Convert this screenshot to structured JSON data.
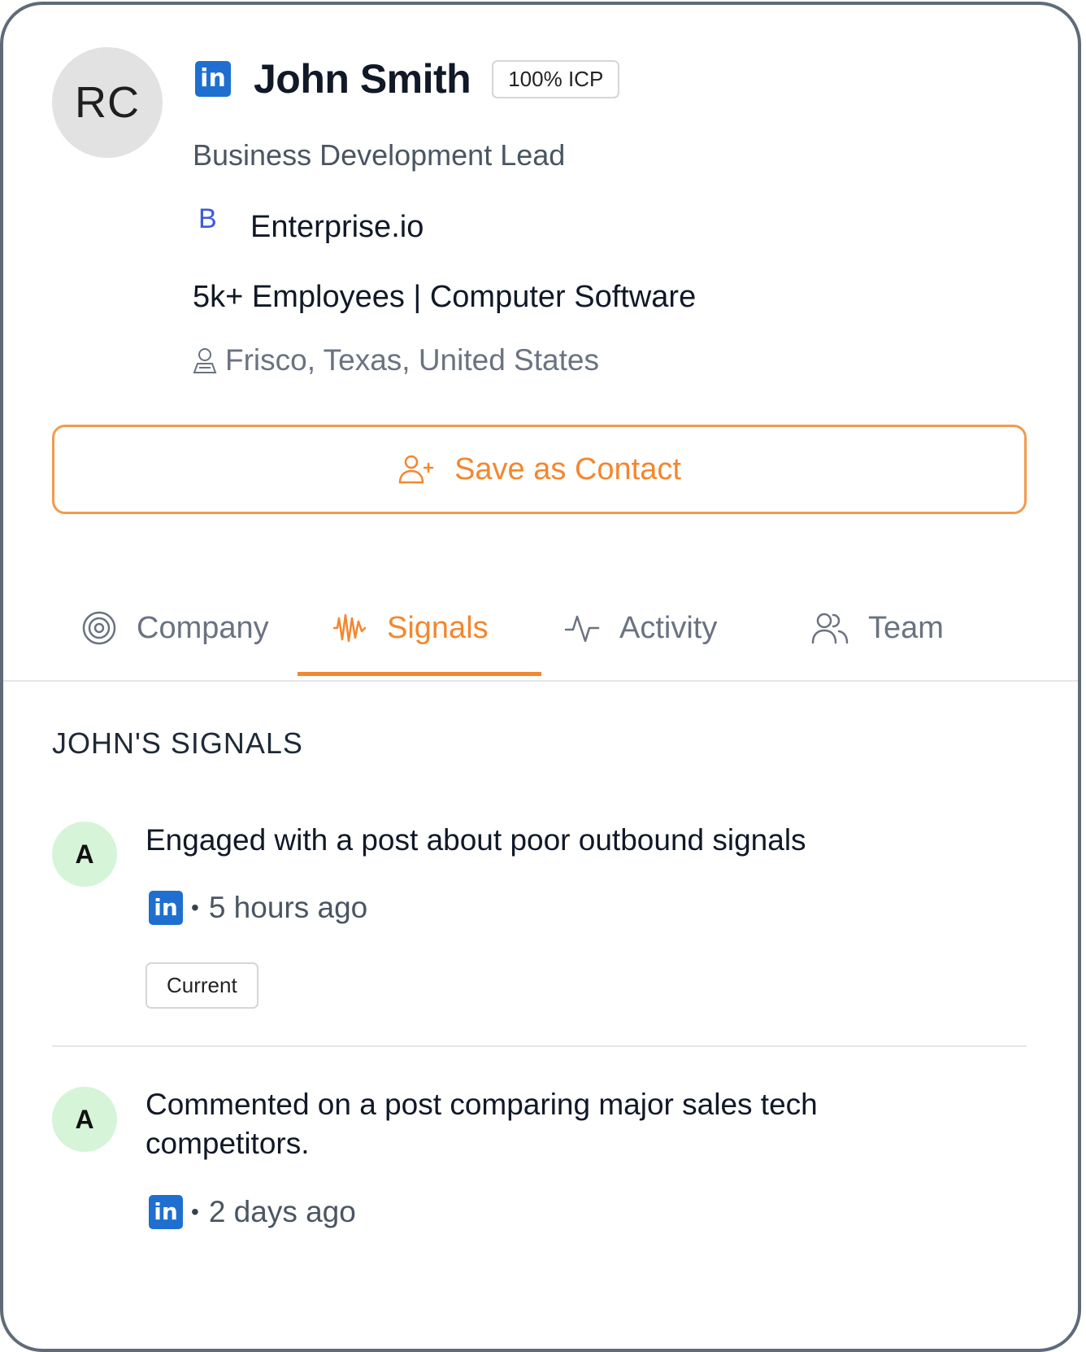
{
  "profile": {
    "avatar_initials": "RC",
    "name": "John Smith",
    "icp_badge": "100% ICP",
    "title": "Business Development Lead",
    "company_logo_letter": "B",
    "company_name": "Enterprise.io",
    "company_meta": "5k+ Employees | Computer Software",
    "location": "Frisco, Texas, United States",
    "linkedin_badge": "in"
  },
  "actions": {
    "save_contact_label": "Save as Contact"
  },
  "tabs": [
    {
      "label": "Company",
      "icon": "target-icon",
      "active": false
    },
    {
      "label": "Signals",
      "icon": "signal-wave-icon",
      "active": true
    },
    {
      "label": "Activity",
      "icon": "activity-icon",
      "active": false
    },
    {
      "label": "Team",
      "icon": "team-icon",
      "active": false
    }
  ],
  "signals": {
    "section_title": "JOHN'S SIGNALS",
    "items": [
      {
        "avatar": "A",
        "text": "Engaged with a post about poor outbound signals",
        "source_badge": "in",
        "separator": "•",
        "time": "5 hours ago",
        "tag": "Current"
      },
      {
        "avatar": "A",
        "text": "Commented on a post comparing major sales tech competitors.",
        "source_badge": "in",
        "separator": "•",
        "time": "2 days ago"
      }
    ]
  },
  "colors": {
    "accent": "#f3872f",
    "linkedin": "#1f6fd1",
    "signal_avatar_bg": "#d5f4d8",
    "frame_border": "#5f6b78"
  }
}
